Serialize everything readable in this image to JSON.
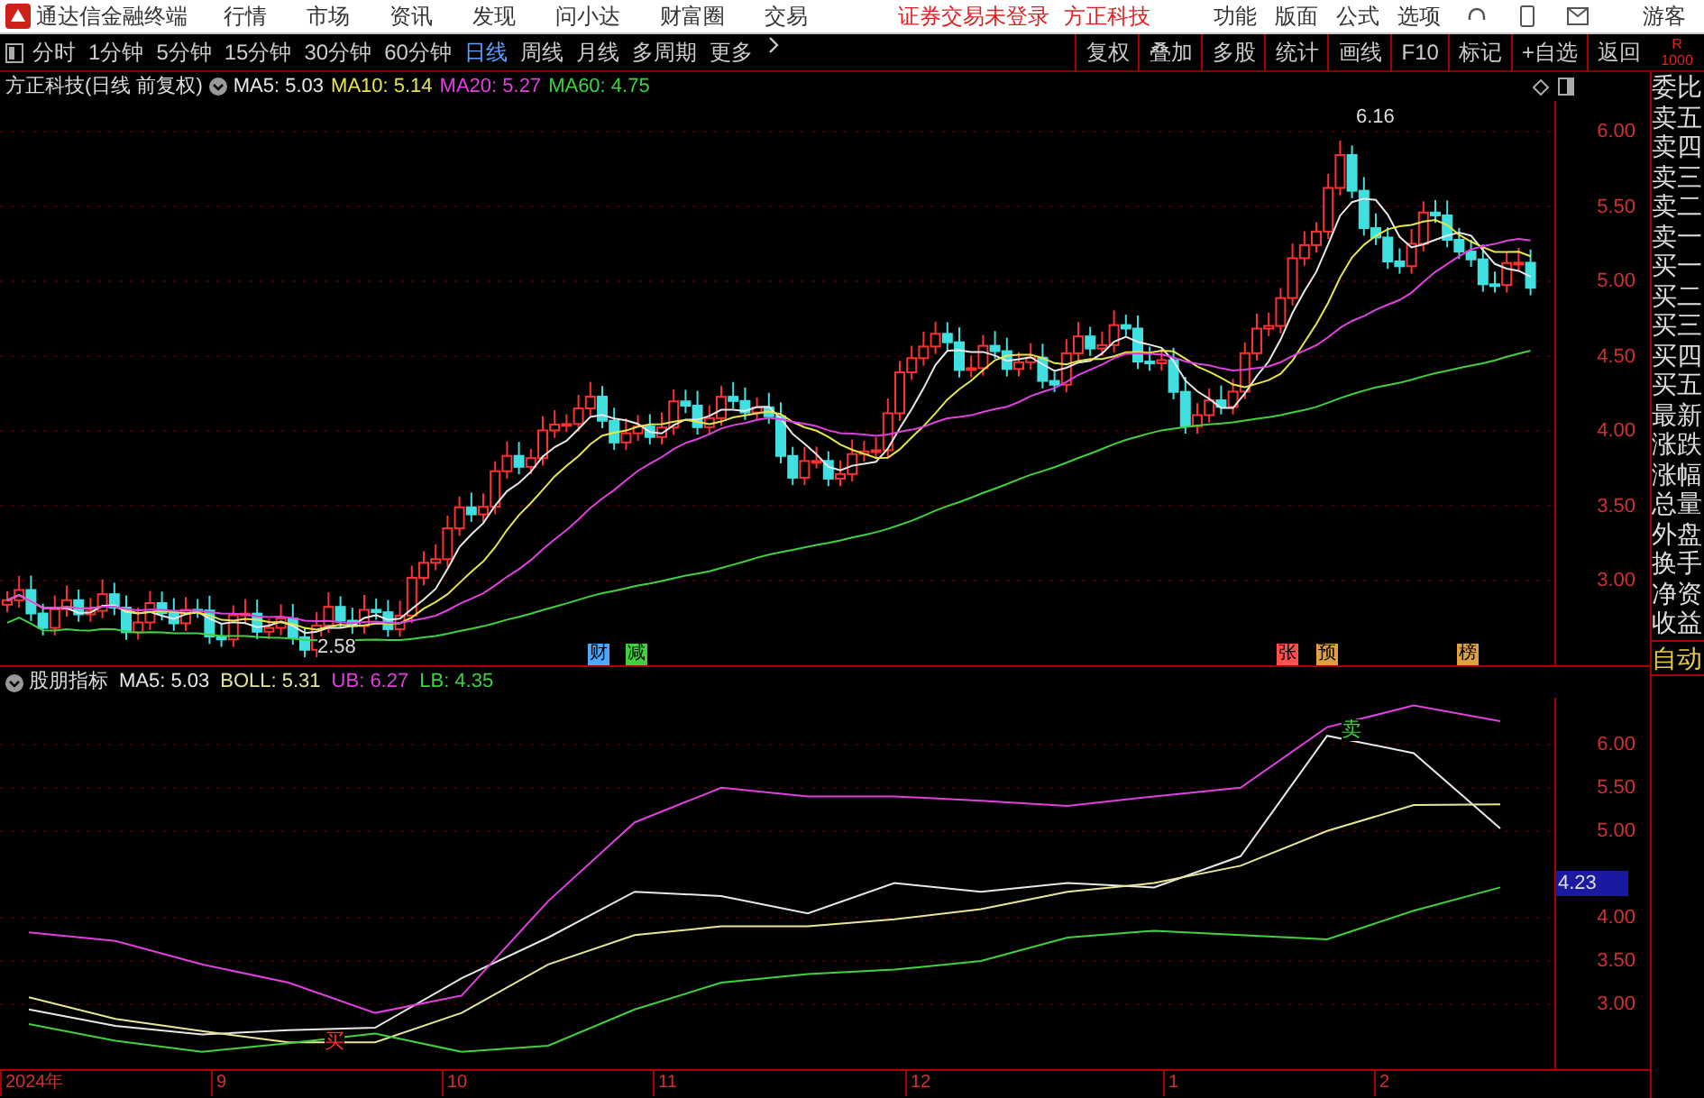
{
  "title_bar": {
    "app_name": "通达信金融终端",
    "menus": [
      "行情",
      "市场",
      "资讯",
      "发现",
      "问小达",
      "财富圈",
      "交易"
    ],
    "notice": "证券交易未登录",
    "stock": "方正科技",
    "right_menus": [
      "功能",
      "版面",
      "公式",
      "选项"
    ],
    "user": "游客"
  },
  "toolbar": {
    "periods": [
      {
        "label": "分时",
        "selected": false
      },
      {
        "label": "1分钟",
        "selected": false
      },
      {
        "label": "5分钟",
        "selected": false
      },
      {
        "label": "15分钟",
        "selected": false
      },
      {
        "label": "30分钟",
        "selected": false
      },
      {
        "label": "60分钟",
        "selected": false
      },
      {
        "label": "日线",
        "selected": true
      },
      {
        "label": "周线",
        "selected": false
      },
      {
        "label": "月线",
        "selected": false
      },
      {
        "label": "多周期",
        "selected": false
      },
      {
        "label": "更多",
        "selected": false
      }
    ],
    "buttons": [
      "复权",
      "叠加",
      "多股",
      "统计",
      "画线",
      "F10",
      "标记",
      "+自选",
      "返回"
    ],
    "corner": [
      "R",
      "1000"
    ]
  },
  "price_panel": {
    "title": "方正科技(日线 前复权)",
    "legend": [
      {
        "text": "MA5: 5.03",
        "color": "#e8e8e8"
      },
      {
        "text": "MA10: 5.14",
        "color": "#e6e64c"
      },
      {
        "text": "MA20: 5.27",
        "color": "#e040e0"
      },
      {
        "text": "MA60: 4.75",
        "color": "#40d040"
      }
    ],
    "axis_labels": [
      "6.00",
      "5.50",
      "5.00",
      "4.50",
      "4.00",
      "3.50",
      "3.00"
    ],
    "high_label": "6.16",
    "low_label": "2.58",
    "markers": [
      {
        "text": "财",
        "color": "#4aa8ff"
      },
      {
        "text": "减",
        "color": "#40d040"
      },
      {
        "text": "张",
        "color": "#ff5050"
      },
      {
        "text": "预",
        "color": "#e0a040"
      },
      {
        "text": "榜",
        "color": "#e0a040"
      }
    ]
  },
  "indicator_panel": {
    "title": "股朋指标",
    "legend_values": [
      ": 5.03",
      ": 5.31",
      ": 6.27",
      ": 4.35"
    ],
    "current_value": "4.23",
    "sell_mark": "卖",
    "buy_mark": "买",
    "chart_data": {
      "type": "line",
      "grid": true,
      "ylim": [
        2.25,
        6.54
      ],
      "yticks": [
        {
          "value": 6.0,
          "label": "6.00"
        },
        {
          "value": 5.5,
          "label": "5.50"
        },
        {
          "value": 5.0,
          "label": "5.00"
        },
        {
          "value": 4.0,
          "label": "4.00"
        },
        {
          "value": 3.5,
          "label": "3.50"
        },
        {
          "value": 3.0,
          "label": "3.00"
        }
      ],
      "series": [
        {
          "name": "MA5",
          "color": "#e8e8e8",
          "values": [
            2.94,
            2.75,
            2.65,
            2.7,
            2.73,
            3.3,
            3.77,
            4.3,
            4.25,
            4.05,
            4.4,
            4.3,
            4.4,
            4.35,
            4.71,
            6.1,
            5.9,
            5.03
          ]
        },
        {
          "name": "BOLL",
          "color": "#e6e69a",
          "values": [
            3.08,
            2.83,
            2.69,
            2.56,
            2.56,
            2.9,
            3.46,
            3.8,
            3.9,
            3.9,
            3.98,
            4.1,
            4.3,
            4.4,
            4.6,
            5.0,
            5.3,
            5.31
          ]
        },
        {
          "name": "UB",
          "color": "#e040e0",
          "values": [
            3.83,
            3.73,
            3.46,
            3.25,
            2.9,
            3.1,
            4.19,
            5.1,
            5.5,
            5.4,
            5.4,
            5.35,
            5.29,
            5.4,
            5.5,
            6.2,
            6.45,
            6.27
          ]
        },
        {
          "name": "LB",
          "color": "#40d040",
          "values": [
            2.77,
            2.58,
            2.45,
            2.55,
            2.66,
            2.45,
            2.52,
            2.94,
            3.25,
            3.35,
            3.4,
            3.5,
            3.77,
            3.85,
            3.8,
            3.75,
            4.08,
            4.35
          ]
        }
      ]
    }
  },
  "date_axis": [
    "2024年",
    "9",
    "10",
    "11",
    "12",
    "1",
    "2"
  ],
  "side_panel": {
    "labels": [
      "委比",
      "卖五",
      "卖四",
      "卖三",
      "卖二",
      "卖一",
      "买一",
      "买二",
      "买三",
      "买四",
      "买五",
      "最新",
      "涨跌",
      "涨幅",
      "总量",
      "外盘",
      "换手",
      "净资",
      "收益"
    ],
    "mode": "自动"
  }
}
